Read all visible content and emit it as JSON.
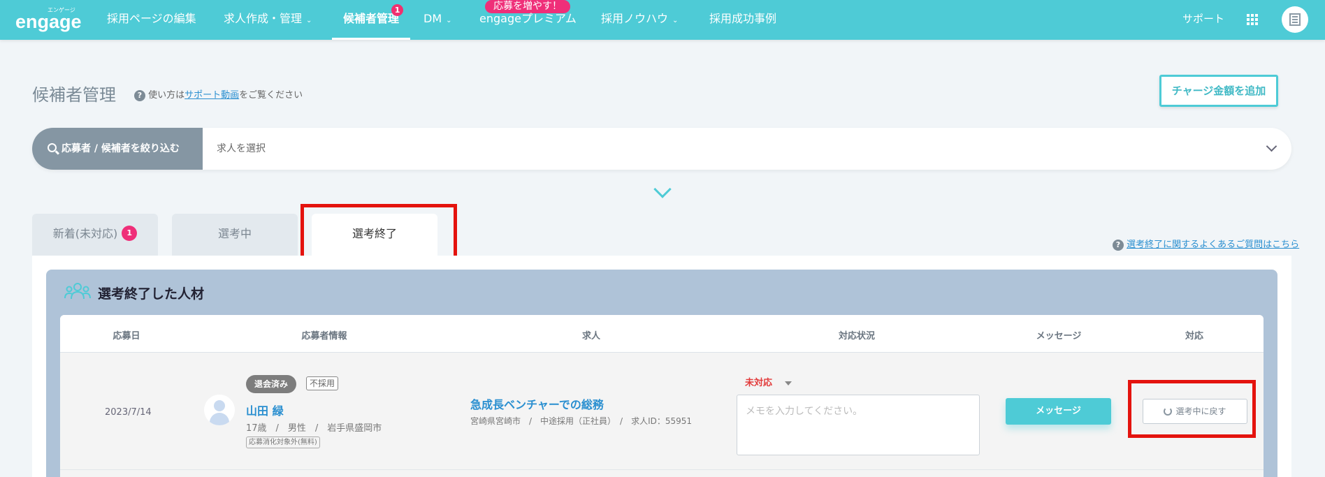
{
  "header": {
    "logo_kana": "エンゲージ",
    "logo_text": "engage",
    "nav": {
      "edit_pages": "採用ページの編集",
      "jobs": "求人作成・管理",
      "candidates": "候補者管理",
      "candidates_badge": "1",
      "dm": "DM",
      "premium": "engageプレミアム",
      "premium_tag": "応募を増やす！",
      "knowhow": "採用ノウハウ",
      "cases": "採用成功事例"
    },
    "support": "サポート"
  },
  "page": {
    "title": "候補者管理",
    "help_prefix": "使い方は",
    "help_link": "サポート動画",
    "help_suffix": "をご覧ください",
    "help_icon": "?",
    "charge_button": "チャージ金額を追加"
  },
  "search": {
    "filter_label": "応募者 / 候補者を絞り込む",
    "job_select": "求人を選択"
  },
  "tabs": [
    {
      "label": "新着(未対応)",
      "badge": "1"
    },
    {
      "label": "選考中"
    },
    {
      "label": "選考終了"
    }
  ],
  "faq": {
    "icon": "?",
    "link": "選考終了に関するよくあるご質問はこちら"
  },
  "section": {
    "title": "選考終了した人材",
    "columns": [
      "応募日",
      "応募者情報",
      "求人",
      "対応状況",
      "メッセージ",
      "対応"
    ]
  },
  "rows": [
    {
      "date": "2023/7/14",
      "status_badge": "退会済み",
      "result_badge": "不採用",
      "name": "山田 緑",
      "meta": "17歳　/　男性　/　岩手県盛岡市",
      "tag": "応募消化対象外(無料)",
      "job_title": "急成長ベンチャーでの総務",
      "job_meta": "宮崎県宮崎市　/　中途採用（正社員）　/　求人ID：55951",
      "response_status": "未対応",
      "memo_placeholder": "メモを入力してください。",
      "message_button": "メッセージ",
      "return_button": "選考中に戻す"
    }
  ],
  "colors": {
    "header_bg": "#4ecbd6",
    "badge_pink": "#ef2f79",
    "link_blue": "#2a8fd0",
    "status_red": "#e23a3a",
    "highlight_red": "#e4130e"
  }
}
